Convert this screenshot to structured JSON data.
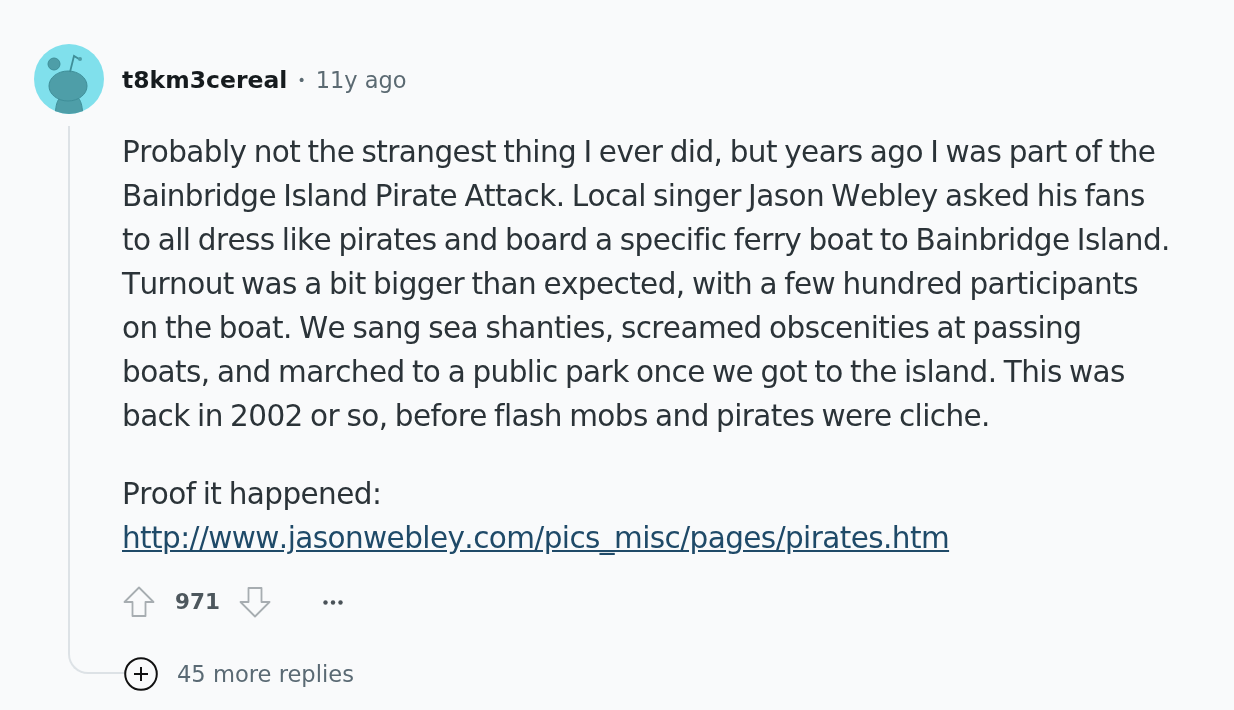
{
  "comment": {
    "author": "t8km3cereal",
    "separator": "•",
    "time": "11y ago",
    "paragraphs": [
      {
        "text": "Probably not the strangest thing I ever did, but years ago I was part of the Bainbridge Island Pirate Attack. Local singer Jason Webley asked his fans to all dress like pirates and board a specific ferry boat to Bainbridge Island. Turnout was a bit bigger than expected, with a few hundred participants on the boat. We sang sea shanties, screamed obscenities at passing boats, and marched to a public park once we got to the island. This was back in 2002 or so, before flash mobs and pirates were cliche."
      },
      {
        "text": "Proof it happened:",
        "link": "http://www.jasonwebley.com/pics_misc/pages/pirates.htm"
      }
    ],
    "score": "971",
    "more_replies": "45 more replies"
  }
}
